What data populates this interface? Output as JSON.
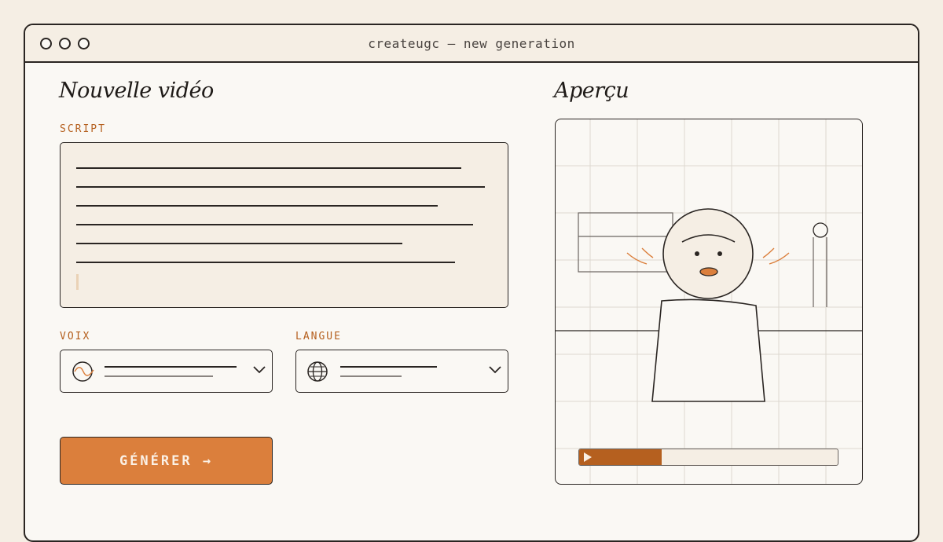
{
  "window": {
    "title": "createugc — new generation"
  },
  "form": {
    "heading": "Nouvelle vidéo",
    "script_label": "SCRIPT",
    "voice_label": "VOIX",
    "language_label": "LANGUE",
    "generate_label": "GÉNÉRER →"
  },
  "preview": {
    "heading": "Aperçu",
    "progress": 0.32
  },
  "colors": {
    "accent": "#db7f3c",
    "accent_dark": "#b5601f",
    "background": "#faf8f4",
    "panel": "#f5eee4",
    "ink": "#2a2522"
  },
  "icons": {
    "voice": "waveform-icon",
    "language": "globe-icon",
    "dropdown": "chevron-down-icon",
    "play": "play-icon"
  }
}
